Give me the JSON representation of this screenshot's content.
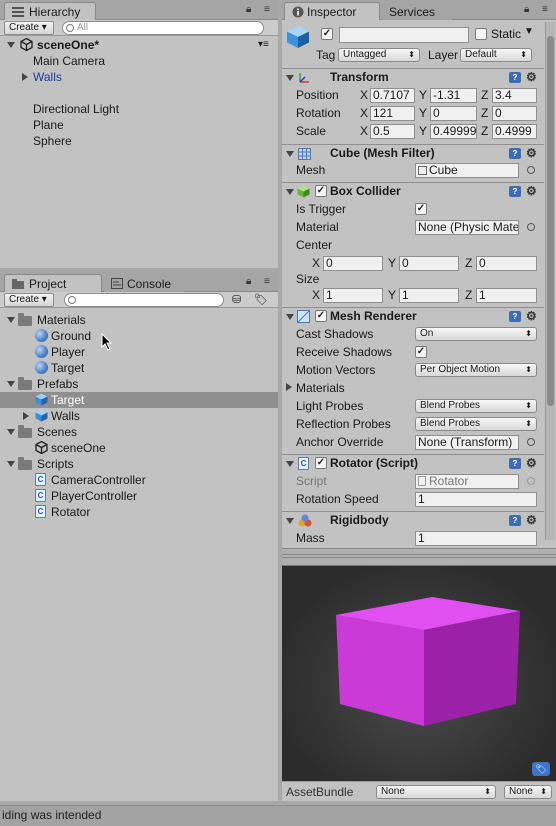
{
  "hierarchy": {
    "tab": "Hierarchy",
    "create": "Create ▾",
    "search_placeholder": "All",
    "scene": "sceneOne*",
    "items": [
      "Main Camera",
      "Walls",
      "Directional Light",
      "Plane",
      "Sphere"
    ]
  },
  "project": {
    "tab": "Project",
    "console_tab": "Console",
    "create": "Create ▾",
    "tree": {
      "materials": "Materials",
      "ground": "Ground",
      "player": "Player",
      "target": "Target",
      "prefabs": "Prefabs",
      "target_prefab": "Target",
      "walls": "Walls",
      "scenes": "Scenes",
      "scene_one": "sceneOne",
      "scripts": "Scripts",
      "camera_controller": "CameraController",
      "player_controller": "PlayerController",
      "rotator": "Rotator"
    }
  },
  "inspector": {
    "tab": "Inspector",
    "services_tab": "Services",
    "name_value": "",
    "static_label": "Static",
    "tag_label": "Tag",
    "tag_value": "Untagged",
    "layer_label": "Layer",
    "layer_value": "Default",
    "transform": {
      "title": "Transform",
      "position_label": "Position",
      "rotation_label": "Rotation",
      "scale_label": "Scale",
      "x": "X",
      "y": "Y",
      "z": "Z",
      "pos": [
        "0.7107",
        "-1.31",
        "3.4"
      ],
      "rot": [
        "121",
        "0",
        "0"
      ],
      "scale": [
        "0.5",
        "0.49999",
        "0.4999"
      ]
    },
    "mesh_filter": {
      "title": "Cube (Mesh Filter)",
      "mesh_label": "Mesh",
      "mesh_value": "Cube"
    },
    "box_collider": {
      "title": "Box Collider",
      "is_trigger": "Is Trigger",
      "material_label": "Material",
      "material_value": "None (Physic Mater",
      "center_label": "Center",
      "center": [
        "0",
        "0",
        "0"
      ],
      "size_label": "Size",
      "size": [
        "1",
        "1",
        "1"
      ]
    },
    "mesh_renderer": {
      "title": "Mesh Renderer",
      "cast_shadows": "Cast Shadows",
      "cast_shadows_value": "On",
      "receive_shadows": "Receive Shadows",
      "motion_vectors": "Motion Vectors",
      "motion_vectors_value": "Per Object Motion",
      "materials": "Materials",
      "light_probes": "Light Probes",
      "light_probes_value": "Blend Probes",
      "reflection_probes": "Reflection Probes",
      "reflection_probes_value": "Blend Probes",
      "anchor_override": "Anchor Override",
      "anchor_override_value": "None (Transform)"
    },
    "rotator": {
      "title": "Rotator (Script)",
      "script_label": "Script",
      "script_value": "Rotator",
      "speed_label": "Rotation Speed",
      "speed_value": "1"
    },
    "rigidbody": {
      "title": "Rigidbody",
      "mass_label": "Mass",
      "mass_value": "1"
    },
    "assetbundle_label": "AssetBundle",
    "assetbundle_value": "None",
    "assetbundle_variant": "None"
  },
  "status_text": "iding was intended",
  "colors": {
    "cube_front": "#c93ad6",
    "cube_top": "#e04ff0",
    "cube_side": "#9b22a8",
    "selection": "#8f8f8f"
  }
}
